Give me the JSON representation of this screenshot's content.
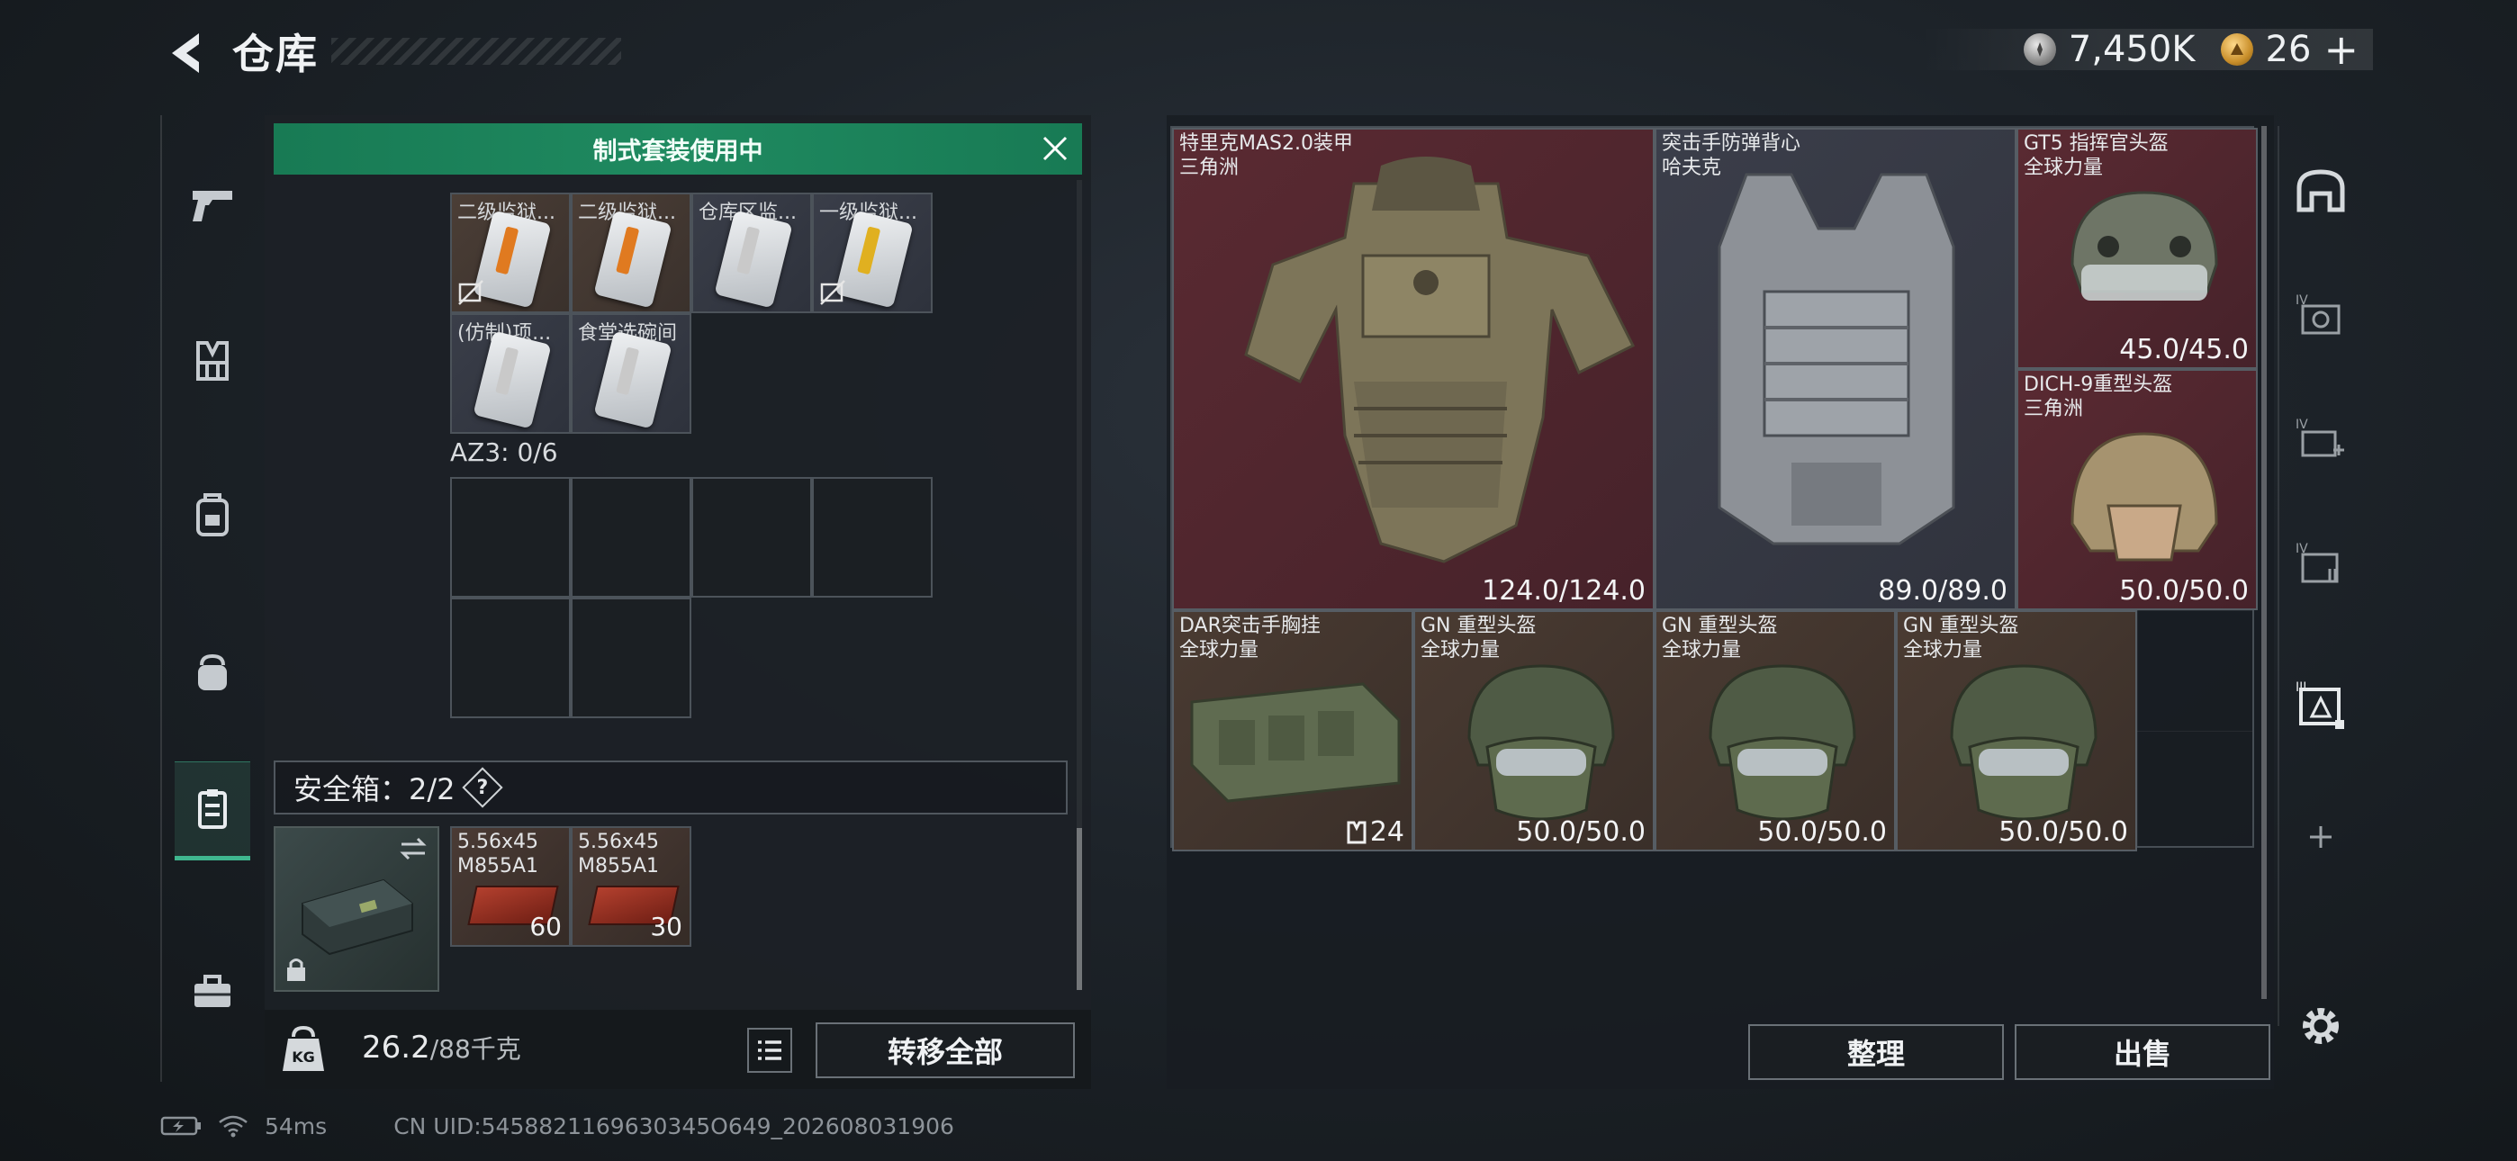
{
  "header": {
    "title": "仓库"
  },
  "currency": {
    "silver_value": "7,450K",
    "gold_value": "26",
    "gold_plus": "+"
  },
  "kit_banner": {
    "text": "制式套装使用中"
  },
  "pouch_items": [
    {
      "label": "二级监狱...",
      "stripe": "#e07a20",
      "locked": true
    },
    {
      "label": "二级监狱...",
      "stripe": "#e07a20",
      "locked": false
    },
    {
      "label": "仓库区监...",
      "stripe": "#c9c9c9",
      "locked": false
    },
    {
      "label": "一级监狱...",
      "stripe": "#e0b020",
      "locked": true
    },
    {
      "label": "(仿制)项...",
      "stripe": "#c9c9c9",
      "locked": false
    },
    {
      "label": "食堂选碗间",
      "stripe": "#c9c9c9",
      "locked": false
    }
  ],
  "az3": {
    "label": "AZ3: 0/6"
  },
  "safe": {
    "label": "安全箱：2/2",
    "help": "?"
  },
  "ammo": [
    {
      "name_line1": "5.56x45",
      "name_line2": "M855A1",
      "count": "60"
    },
    {
      "name_line1": "5.56x45",
      "name_line2": "M855A1",
      "count": "30"
    }
  ],
  "weight": {
    "current": "26.2",
    "max": "/88千克",
    "transfer_all": "转移全部"
  },
  "stash": [
    {
      "name1": "特里克MAS2.0装甲",
      "name2": "三角洲",
      "durability": "124.0/124.0"
    },
    {
      "name1": "突击手防弹背心",
      "name2": "哈夫克",
      "durability": "89.0/89.0"
    },
    {
      "name1": "GT5 指挥官头盔",
      "name2": "全球力量",
      "durability": "45.0/45.0"
    },
    {
      "name1": "DICH-9重型头盔",
      "name2": "三角洲",
      "durability": "50.0/50.0"
    },
    {
      "name1": "DAR突击手胸挂",
      "name2": "全球力量",
      "qty": "24"
    },
    {
      "name1": "GN 重型头盔",
      "name2": "全球力量",
      "durability": "50.0/50.0"
    },
    {
      "name1": "GN 重型头盔",
      "name2": "全球力量",
      "durability": "50.0/50.0"
    },
    {
      "name1": "GN 重型头盔",
      "name2": "全球力量",
      "durability": "50.0/50.0"
    }
  ],
  "actions": {
    "sort": "整理",
    "sell": "出售"
  },
  "side_icons": [
    "IV",
    "IV",
    "IV",
    "III"
  ],
  "status": {
    "ping": "54ms",
    "uid": "CN UID:5458821169630345O649_202608031906"
  },
  "colors": {
    "accent": "#1f8a60",
    "red_rarity": "#5a2a32",
    "brown_rarity": "#4a3b32"
  }
}
